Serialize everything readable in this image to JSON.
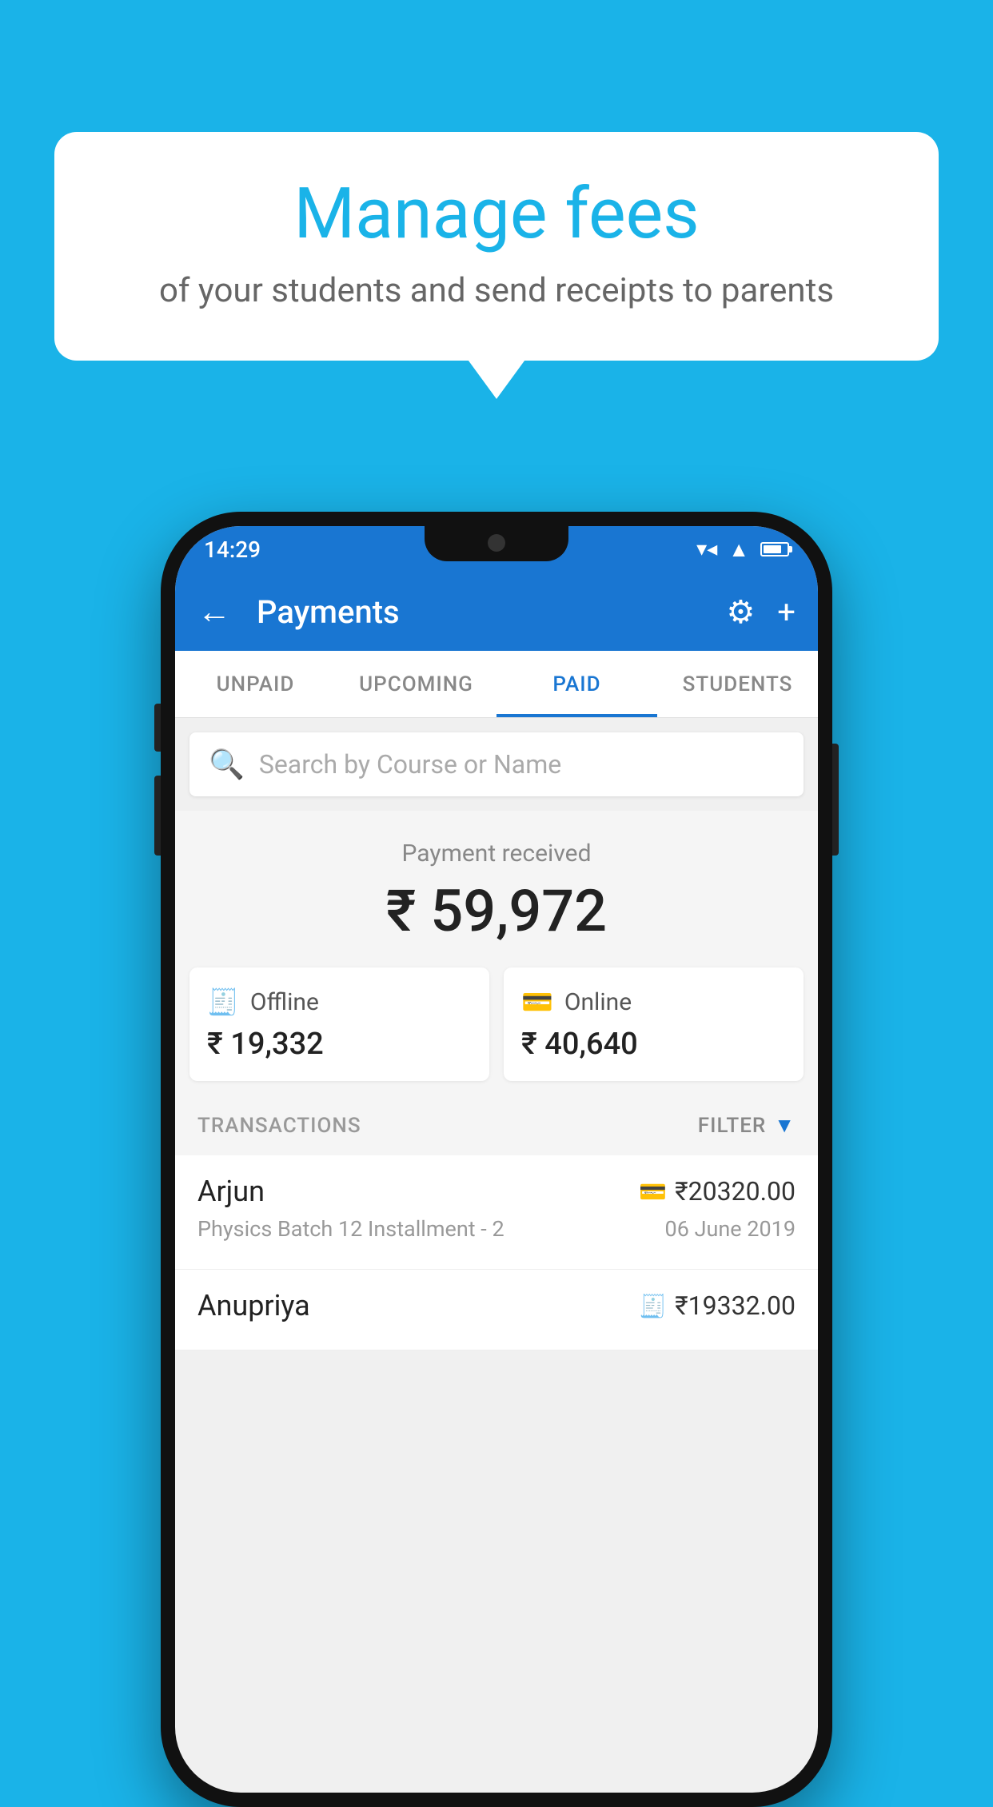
{
  "background_color": "#1ab3e8",
  "speech_bubble": {
    "title": "Manage fees",
    "subtitle": "of your students and send receipts to parents"
  },
  "phone": {
    "status_bar": {
      "time": "14:29"
    },
    "app_bar": {
      "title": "Payments",
      "back_label": "←",
      "gear_label": "⚙",
      "plus_label": "+"
    },
    "tabs": [
      {
        "label": "UNPAID",
        "active": false
      },
      {
        "label": "UPCOMING",
        "active": false
      },
      {
        "label": "PAID",
        "active": true
      },
      {
        "label": "STUDENTS",
        "active": false
      }
    ],
    "search": {
      "placeholder": "Search by Course or Name"
    },
    "payment_summary": {
      "label": "Payment received",
      "amount": "₹ 59,972",
      "offline": {
        "label": "Offline",
        "amount": "₹ 19,332"
      },
      "online": {
        "label": "Online",
        "amount": "₹ 40,640"
      }
    },
    "transactions": {
      "header": "TRANSACTIONS",
      "filter_label": "FILTER",
      "items": [
        {
          "name": "Arjun",
          "amount": "₹20320.00",
          "payment_type": "online",
          "detail": "Physics Batch 12 Installment - 2",
          "date": "06 June 2019"
        },
        {
          "name": "Anupriya",
          "amount": "₹19332.00",
          "payment_type": "offline",
          "detail": "",
          "date": ""
        }
      ]
    }
  }
}
